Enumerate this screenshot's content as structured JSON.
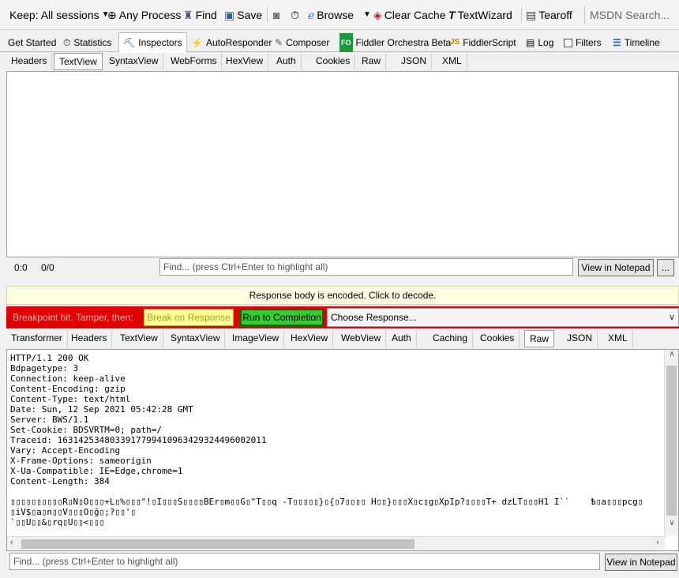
{
  "toolbar": {
    "keep_sessions": "Keep: All sessions",
    "any_process": "Any Process",
    "find": "Find",
    "save": "Save",
    "browse": "Browse",
    "clear_cache": "Clear Cache",
    "textwizard": "TextWizard",
    "tearoff": "Tearoff",
    "search_placeholder": "MSDN Search..."
  },
  "main_tabs": {
    "get_started": "Get Started",
    "statistics": "Statistics",
    "inspectors": "Inspectors",
    "autoresponder": "AutoResponder",
    "composer": "Composer",
    "orchestra_badge": "FO",
    "orchestra": "Fiddler Orchestra Beta",
    "fiddlerscript": "FiddlerScript",
    "log": "Log",
    "filters": "Filters",
    "timeline": "Timeline"
  },
  "request_tabs": [
    "Headers",
    "TextView",
    "SyntaxView",
    "WebForms",
    "HexView",
    "Auth",
    "Cookies",
    "Raw",
    "JSON",
    "XML"
  ],
  "request_status": {
    "position": "0:0",
    "count": "0/0",
    "find_placeholder": "Find... (press Ctrl+Enter to highlight all)",
    "view_notepad": "View in Notepad",
    "more": "..."
  },
  "encoded_notice": "Response body is encoded. Click to decode.",
  "breakpoint": {
    "label": "Breakpoint hit. Tamper, then:",
    "break_on_response": "Break on Response",
    "run_to_completion": "Run to Completion",
    "choose_response": "Choose Response..."
  },
  "response_tabs": [
    "Transformer",
    "Headers",
    "TextView",
    "SyntaxView",
    "ImageView",
    "HexView",
    "WebView",
    "Auth",
    "Caching",
    "Cookies",
    "Raw",
    "JSON",
    "XML"
  ],
  "response_raw": "HTTP/1.1 200 OK\nBdpagetype: 3\nConnection: keep-alive\nContent-Encoding: gzip\nContent-Type: text/html\nDate: Sun, 12 Sep 2021 05:42:28 GMT\nServer: BWS/1.1\nSet-Cookie: BDSVRTM=0; path=/\nTraceid: 1631425348033917799410963429324496002011\nVary: Accept-Encoding\nX-Frame-Options: sameorigin\nX-Ua-Compatible: IE=Edge,chrome=1\nContent-Length: 384\n\n▯▯▯▯▯▯▯▯▯▯R▯N▯O▯▯▯+L▯%▯▯▯\"!▯I▯▯▯S▯▯▯▯BEr▯m▯▯G▯\"T▯▯q -T▯▯▯▯▯}▯{▯7▯▯▯▯ H▯▯}▯▯▯X▯c▯g▯XpIp?▯▯▯▯T+ dzLT▯▯▯H1 I``    Ѣ▯a▯▯▯pcg▯\n▯iV$▯a▯n▯▯V▯▯▯O▯ğ▯;?▯▯'▯\n`▯▯U▯▯&▯rq▯U▯▯<▯▯▯",
  "response_find": {
    "find_placeholder": "Find... (press Ctrl+Enter to highlight all)",
    "view_notepad": "View in Notepad"
  }
}
